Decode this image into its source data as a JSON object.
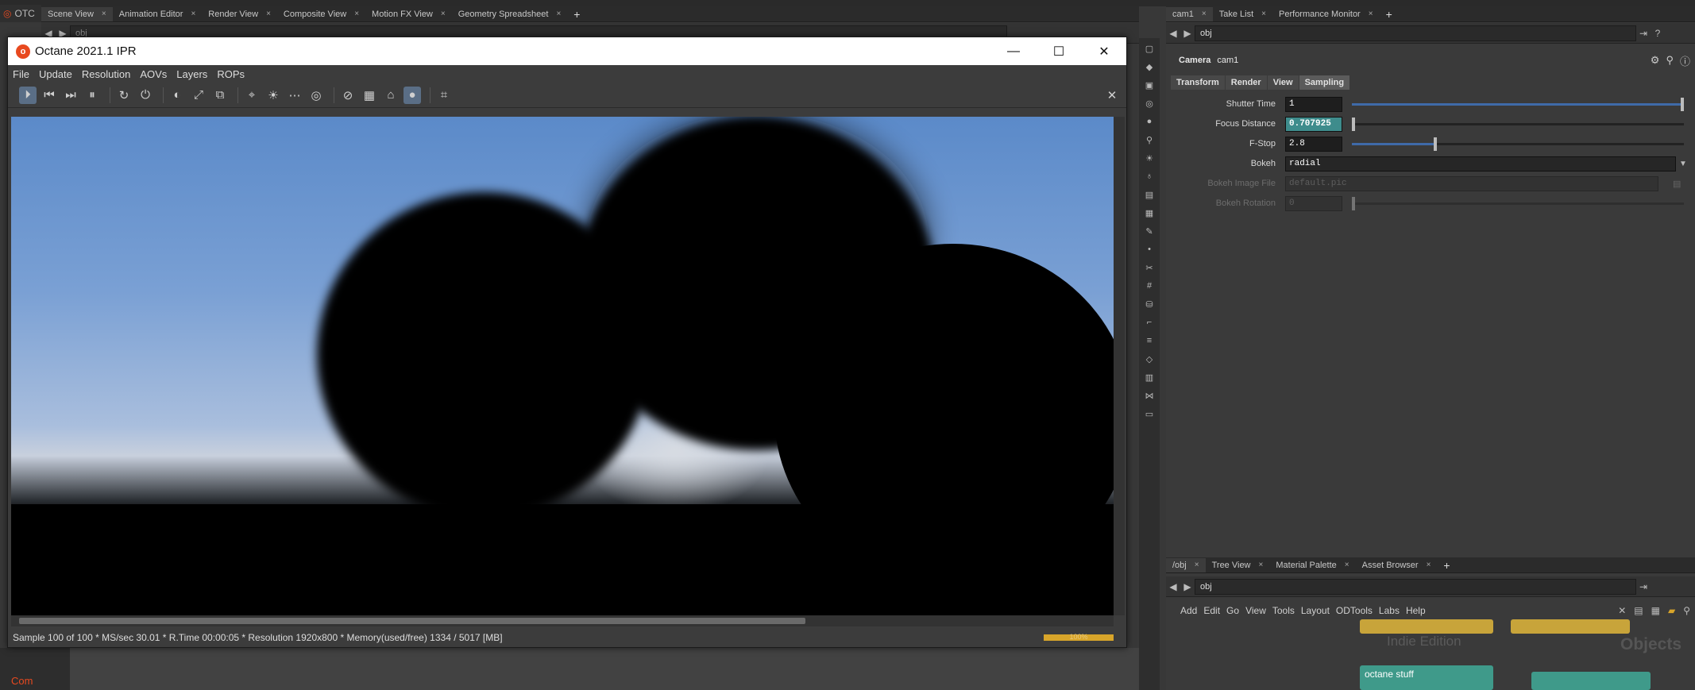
{
  "houdini": {
    "scene_tabs": [
      {
        "label": "Scene View"
      },
      {
        "label": "Animation Editor"
      },
      {
        "label": "Render View"
      },
      {
        "label": "Composite View"
      },
      {
        "label": "Motion FX View"
      },
      {
        "label": "Geometry Spreadsheet"
      }
    ],
    "right_tabs": [
      {
        "label": "cam1"
      },
      {
        "label": "Take List"
      },
      {
        "label": "Performance Monitor"
      }
    ],
    "path_top": "obj",
    "path_left": "obj",
    "left_label": "OTC",
    "left_bottom": "Com",
    "node_tabs": [
      {
        "label": "/obj"
      },
      {
        "label": "Tree View"
      },
      {
        "label": "Material Palette"
      },
      {
        "label": "Asset Browser"
      }
    ],
    "path_bottom": "obj",
    "network_menu": [
      "Add",
      "Edit",
      "Go",
      "View",
      "Tools",
      "Layout",
      "ODTools",
      "Labs",
      "Help"
    ],
    "network_watermark": "Indie Edition",
    "network_context": "Objects",
    "network_node": "octane stuff"
  },
  "octane": {
    "title": "Octane 2021.1 IPR",
    "logo_glyph": "o",
    "menu": [
      "File",
      "Update",
      "Resolution",
      "AOVs",
      "Layers",
      "ROPs"
    ],
    "status": "Sample 100 of 100 * MS/sec 30.01 * R.Time 00:00:05 * Resolution 1920x800 * Memory(used/free) 1334 / 5017 [MB]",
    "progress_label": "100%",
    "progress": 1.0,
    "colors": {
      "accent": "#e8491f",
      "progress": "#d8a52a"
    }
  },
  "params": {
    "node_type": "Camera",
    "node_name": "cam1",
    "tabs": [
      "Transform",
      "Render",
      "View",
      "Sampling"
    ],
    "active_tab": "Sampling",
    "rows": [
      {
        "label": "Shutter Time",
        "value": "1",
        "level": 1.0
      },
      {
        "label": "Focus Distance",
        "value": "0.707925",
        "level": 0.0
      },
      {
        "label": "F-Stop",
        "value": "2.8",
        "level": 0.25
      },
      {
        "label": "Bokeh",
        "value": "radial"
      },
      {
        "label": "Bokeh Image File",
        "value": "default.pic"
      },
      {
        "label": "Bokeh Rotation",
        "value": "0",
        "level": 0.0
      }
    ]
  }
}
